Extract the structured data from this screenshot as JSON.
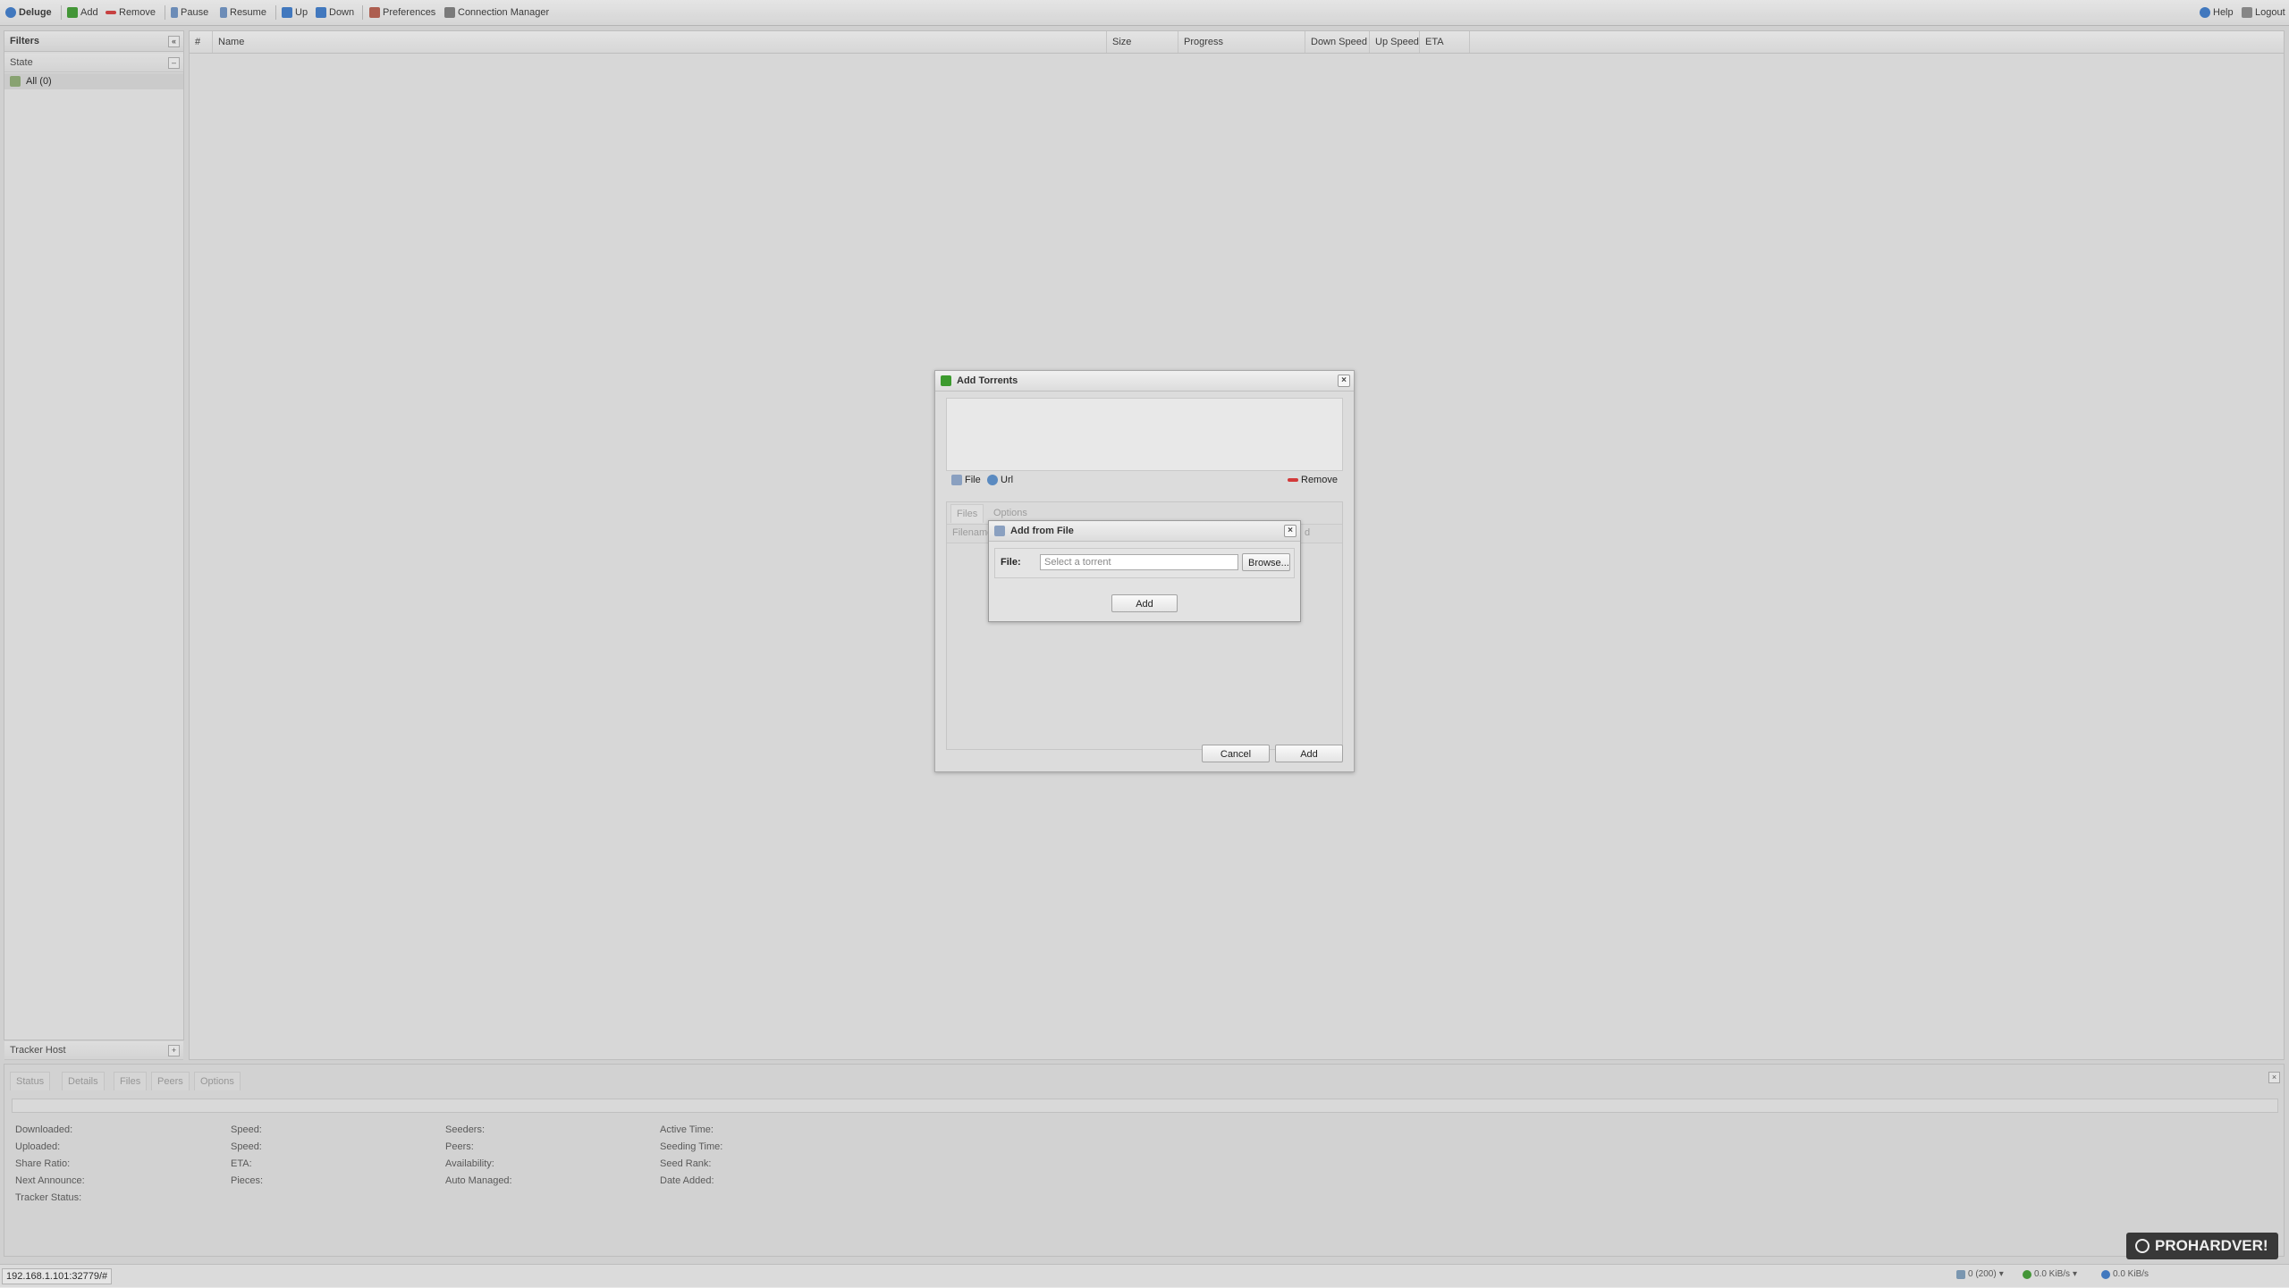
{
  "toolbar": {
    "app_title": "Deluge",
    "add": "Add",
    "remove": "Remove",
    "pause": "Pause",
    "resume": "Resume",
    "up": "Up",
    "down": "Down",
    "preferences": "Preferences",
    "connection_manager": "Connection Manager",
    "help": "Help",
    "logout": "Logout"
  },
  "filters": {
    "title": "Filters",
    "state_header": "State",
    "all_item": "All (0)",
    "tracker_host_header": "Tracker Host"
  },
  "grid": {
    "columns": [
      "#",
      "Name",
      "Size",
      "Progress",
      "Down Speed",
      "Up Speed",
      "ETA"
    ]
  },
  "details": {
    "tabs": [
      "Status",
      "Details",
      "Files",
      "Peers",
      "Options"
    ],
    "col1": [
      "Downloaded:",
      "Uploaded:",
      "Share Ratio:",
      "Next Announce:",
      "Tracker Status:"
    ],
    "col2": [
      "Speed:",
      "Speed:",
      "ETA:",
      "Pieces:"
    ],
    "col3": [
      "Seeders:",
      "Peers:",
      "Availability:",
      "Auto Managed:"
    ],
    "col4": [
      "Active Time:",
      "Seeding Time:",
      "Seed Rank:",
      "Date Added:"
    ]
  },
  "statusbar": {
    "url": "192.168.1.101:32779/#",
    "connections": "0 (200)",
    "down_speed": "0.0 KiB/s",
    "up_speed": "0.0 KiB/s",
    "watermark": "PROHARDVER!"
  },
  "add_torrents_dialog": {
    "title": "Add Torrents",
    "file_btn": "File",
    "url_btn": "Url",
    "remove_btn": "Remove",
    "tab_files": "Files",
    "tab_options": "Options",
    "col_filename": "Filename",
    "col_partial": "d",
    "cancel_btn": "Cancel",
    "add_btn": "Add"
  },
  "add_from_file_dialog": {
    "title": "Add from File",
    "file_label": "File:",
    "file_placeholder": "Select a torrent",
    "browse_btn": "Browse...",
    "add_btn": "Add"
  },
  "colors": {
    "add_green": "#3c9a2e",
    "remove_red": "#d23a3a",
    "toolbar_blue": "#3a78c8"
  }
}
